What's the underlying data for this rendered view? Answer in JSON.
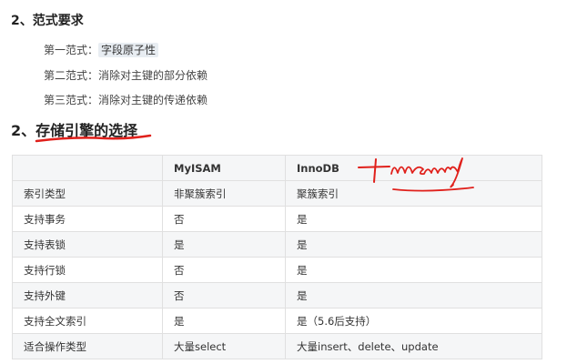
{
  "section1": {
    "title": "2、范式要求",
    "items": [
      {
        "label": "第一范式：",
        "value": "字段原子性"
      },
      {
        "label": "第二范式：",
        "value": "消除对主键的部分依赖"
      },
      {
        "label": "第三范式：",
        "value": "消除对主键的传递依赖"
      }
    ]
  },
  "section2": {
    "title": "2、存储引擎的选择"
  },
  "table": {
    "headers": [
      "",
      "MyISAM",
      "InnoDB"
    ],
    "rows": [
      [
        "索引类型",
        "非聚簇索引",
        "聚簇索引"
      ],
      [
        "支持事务",
        "否",
        "是"
      ],
      [
        "支持表锁",
        "是",
        "是"
      ],
      [
        "支持行锁",
        "否",
        "是"
      ],
      [
        "支持外键",
        "否",
        "是"
      ],
      [
        "支持全文索引",
        "是",
        "是（5.6后支持）"
      ],
      [
        "适合操作类型",
        "大量select",
        "大量insert、delete、update"
      ]
    ]
  },
  "colors": {
    "annotation_red": "#e0201b",
    "header_bg": "#f5f6f7",
    "highlight_bg": "#e8edf2"
  }
}
